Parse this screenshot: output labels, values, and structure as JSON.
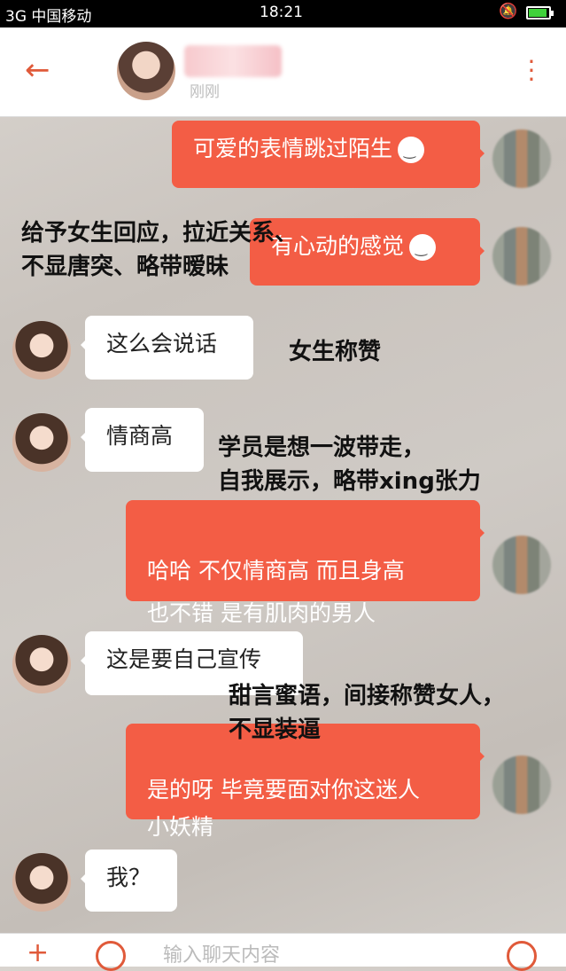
{
  "status_bar": {
    "carrier": "3G 中国移动",
    "time": "18:21"
  },
  "header": {
    "contact_subtitle": "刚刚"
  },
  "messages": [
    {
      "side": "out",
      "text": "可爱的表情跳过陌生"
    },
    {
      "side": "out",
      "text": "有心动的感觉"
    },
    {
      "side": "in",
      "text": "这么会说话"
    },
    {
      "side": "in",
      "text": "情商高"
    },
    {
      "side": "out",
      "text": "哈哈 不仅情商高 而且身高\n也不错 是有肌肉的男人"
    },
    {
      "side": "in",
      "text": "这是要自己宣传"
    },
    {
      "side": "out",
      "text": "是的呀 毕竟要面对你这迷人\n小妖精"
    },
    {
      "side": "in",
      "text": "我？"
    }
  ],
  "annotations": {
    "a1": "给予女生回应，拉近关系、\n不显唐突、略带暧昧",
    "a2": "女生称赞",
    "a3": "学员是想一波带走，\n自我展示，略带xing张力",
    "a4": "甜言蜜语，间接称赞女人，\n不显装逼"
  },
  "input": {
    "placeholder": "输入聊天内容"
  },
  "icons": [
    "signal-icon",
    "wifi-icon",
    "bell-muted-icon",
    "battery-icon",
    "back-arrow-icon",
    "more-icon",
    "emoji-icon",
    "plus-icon",
    "voice-icon"
  ],
  "colors": {
    "accent": "#f35d45",
    "header_icon": "#e05a3a"
  }
}
